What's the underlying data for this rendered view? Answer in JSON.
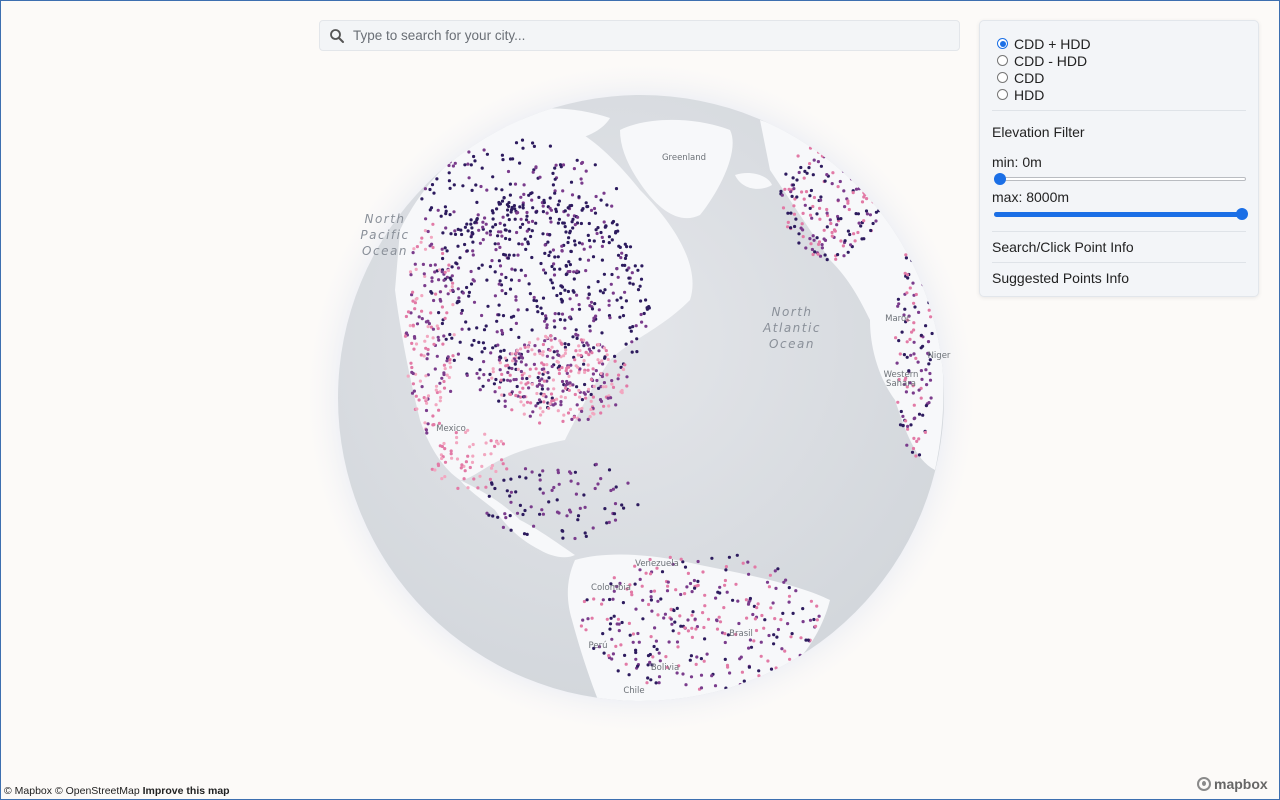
{
  "search": {
    "placeholder": "Type to search for your city..."
  },
  "panel": {
    "modes": [
      {
        "label": "CDD + HDD",
        "checked": true
      },
      {
        "label": "CDD - HDD",
        "checked": false
      },
      {
        "label": "CDD",
        "checked": false
      },
      {
        "label": "HDD",
        "checked": false
      }
    ],
    "elevation_title": "Elevation Filter",
    "min_label": "min: 0m",
    "max_label": "max: 8000m",
    "min_value_fraction": 0,
    "max_value_fraction": 1,
    "search_click_info": "Search/Click Point Info",
    "suggested_points_info": "Suggested Points Info"
  },
  "map_labels": {
    "north_pacific": [
      "North",
      "Pacific",
      "Ocean"
    ],
    "north_atlantic": [
      "North",
      "Atlantic",
      "Ocean"
    ],
    "greenland": "Greenland",
    "mexico": "Mexico",
    "venezuela": "Venezuela",
    "colombia": "Colombia",
    "brazil": "Brasil",
    "chile": "Chile",
    "peru": "Perú",
    "bolivia": "Bolivia",
    "western_sahara": [
      "Western",
      "Sahara"
    ],
    "niger": "Niger",
    "morocco": "Maroc"
  },
  "attribution": {
    "mapbox": "© Mapbox",
    "osm": "© OpenStreetMap",
    "improve": "Improve this map"
  },
  "logo_text": "mapbox",
  "colors": {
    "accent": "#1b6fe6",
    "dot_dark": "#2d1b5e",
    "dot_mid": "#7a3c8c",
    "dot_pink": "#e27aa6",
    "dot_light": "#f2a7c0"
  }
}
